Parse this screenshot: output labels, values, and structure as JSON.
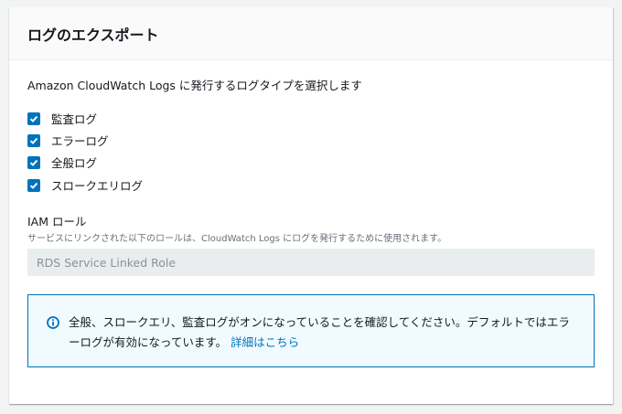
{
  "title": "ログのエクスポート",
  "description": "Amazon CloudWatch Logs に発行するログタイプを選択します",
  "log_types": [
    {
      "label": "監査ログ",
      "checked": true
    },
    {
      "label": "エラーログ",
      "checked": true
    },
    {
      "label": "全般ログ",
      "checked": true
    },
    {
      "label": "スロークエリログ",
      "checked": true
    }
  ],
  "iam": {
    "label": "IAM ロール",
    "hint": "サービスにリンクされた以下のロールは、CloudWatch Logs にログを発行するために使用されます。",
    "value": "RDS Service Linked Role"
  },
  "info": {
    "icon": "info-icon",
    "text": "全般、スロークエリ、監査ログがオンになっていることを確認してください。デフォルトではエラーログが有効になっています。",
    "link": "詳細はこちら"
  }
}
